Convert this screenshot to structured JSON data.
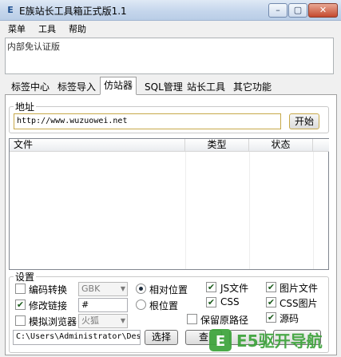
{
  "window": {
    "title": "E族站长工具箱正式版1.1",
    "icon_glyph": "E",
    "controls": {
      "minimize": "–",
      "maximize": "▢",
      "close": "✕"
    }
  },
  "menu": {
    "items": [
      "菜单",
      "工具",
      "帮助"
    ]
  },
  "notice": {
    "text": "内部免认证版"
  },
  "tabs": {
    "items": [
      "标签中心",
      "标签导入",
      "仿站器",
      "SQL管理",
      "站长工具",
      "其它功能"
    ],
    "active": "仿站器"
  },
  "address": {
    "group_title": "地址",
    "url_value": "http://www.wuzuowei.net",
    "start_label": "开始"
  },
  "file_list": {
    "columns": [
      "文件",
      "类型",
      "状态"
    ],
    "rows": []
  },
  "settings": {
    "group_title": "设置",
    "encode_convert": {
      "label": "编码转换",
      "checked": false,
      "combo_value": "GBK"
    },
    "modify_links": {
      "label": "修改链接",
      "checked": true,
      "field_value": "#"
    },
    "simulate_browser": {
      "label": "模拟浏览器",
      "checked": false,
      "combo_value": "火狐"
    },
    "relative_position": {
      "label": "相对位置",
      "selected": true
    },
    "root_position": {
      "label": "根位置",
      "selected": false
    },
    "keep_original_path": {
      "label": "保留原路径",
      "checked": false
    },
    "js_files": {
      "label": "JS文件",
      "checked": true
    },
    "css": {
      "label": "CSS",
      "checked": true
    },
    "image_files": {
      "label": "图片文件",
      "checked": true
    },
    "css_images": {
      "label": "CSS图片",
      "checked": true
    },
    "source_code": {
      "label": "源码",
      "checked": true
    },
    "save_path_value": "C:\\Users\\Administrator\\Desl",
    "choose_label": "选择",
    "view_label": "查",
    "hidden_button_1": "",
    "hidden_button_2": ""
  },
  "watermark": {
    "text": "E5驱开导航"
  },
  "colors": {
    "accent_green": "#3ca33a",
    "title_bar": "#c5d6ec",
    "start_button_border": "#c7a94a"
  }
}
